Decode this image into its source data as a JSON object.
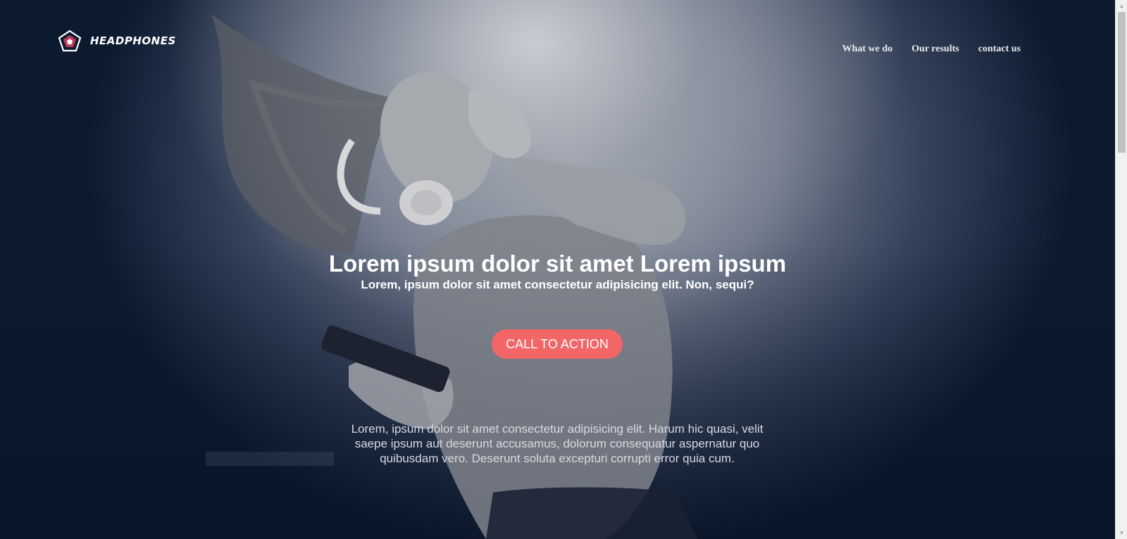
{
  "header": {
    "logo_text": "HEADPHONES",
    "nav": [
      {
        "label": "What we do"
      },
      {
        "label": "Our results"
      },
      {
        "label": "contact us"
      }
    ]
  },
  "hero": {
    "title": "Lorem ipsum dolor sit amet Lorem ipsum",
    "subtitle": "Lorem, ipsum dolor sit amet consectetur adipisicing elit. Non, sequi?",
    "cta_label": "CALL TO ACTION",
    "body_text": "Lorem, ipsum dolor sit amet consectetur adipisicing elit. Harum hic quasi, velit saepe ipsum aut deserunt accusamus, dolorum consequatur aspernatur quo quibusdam vero. Deserunt soluta excepturi corrupti error quia cum."
  },
  "colors": {
    "cta": "#f26667",
    "logo_accent": "#c0395a",
    "overlay_dark": "#0c1a30"
  },
  "icons": {
    "logo": "pentagon-logo-icon",
    "scroll_up": "arrow-up-icon",
    "scroll_down": "arrow-down-icon"
  }
}
